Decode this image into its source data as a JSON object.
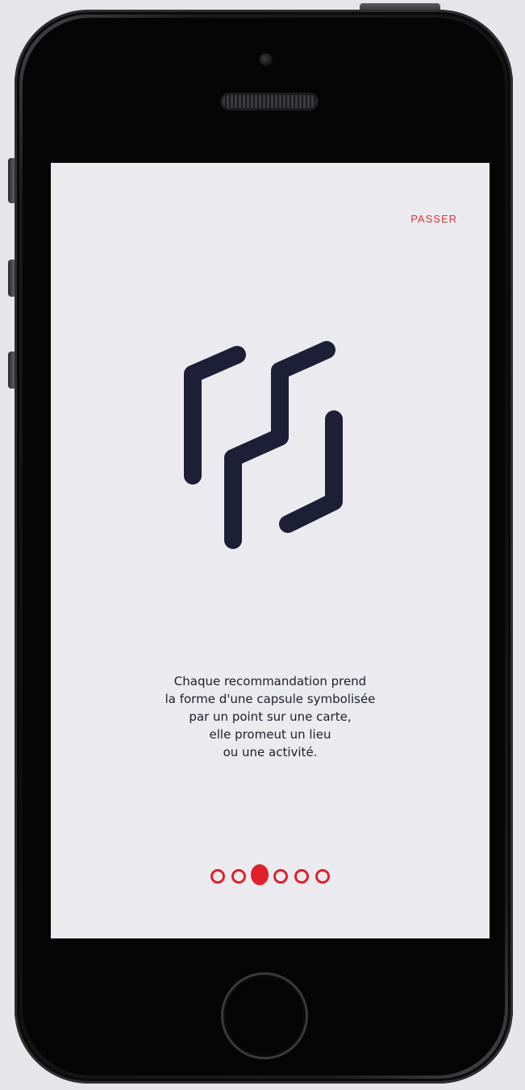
{
  "onboarding": {
    "skip_label": "PASSER",
    "caption_lines": [
      "Chaque recommandation prend",
      "la forme d'une capsule symbolisée",
      "par un point sur une carte,",
      "elle promeut un lieu",
      "ou une activité."
    ],
    "pagination": {
      "total": 6,
      "current": 3
    }
  },
  "colors": {
    "accent": "#e0202b",
    "logo": "#1c1f36",
    "text": "#1c1f2b",
    "screen_bg": "#ebebef"
  },
  "icons": {
    "logo": "capsule-logo-icon"
  }
}
